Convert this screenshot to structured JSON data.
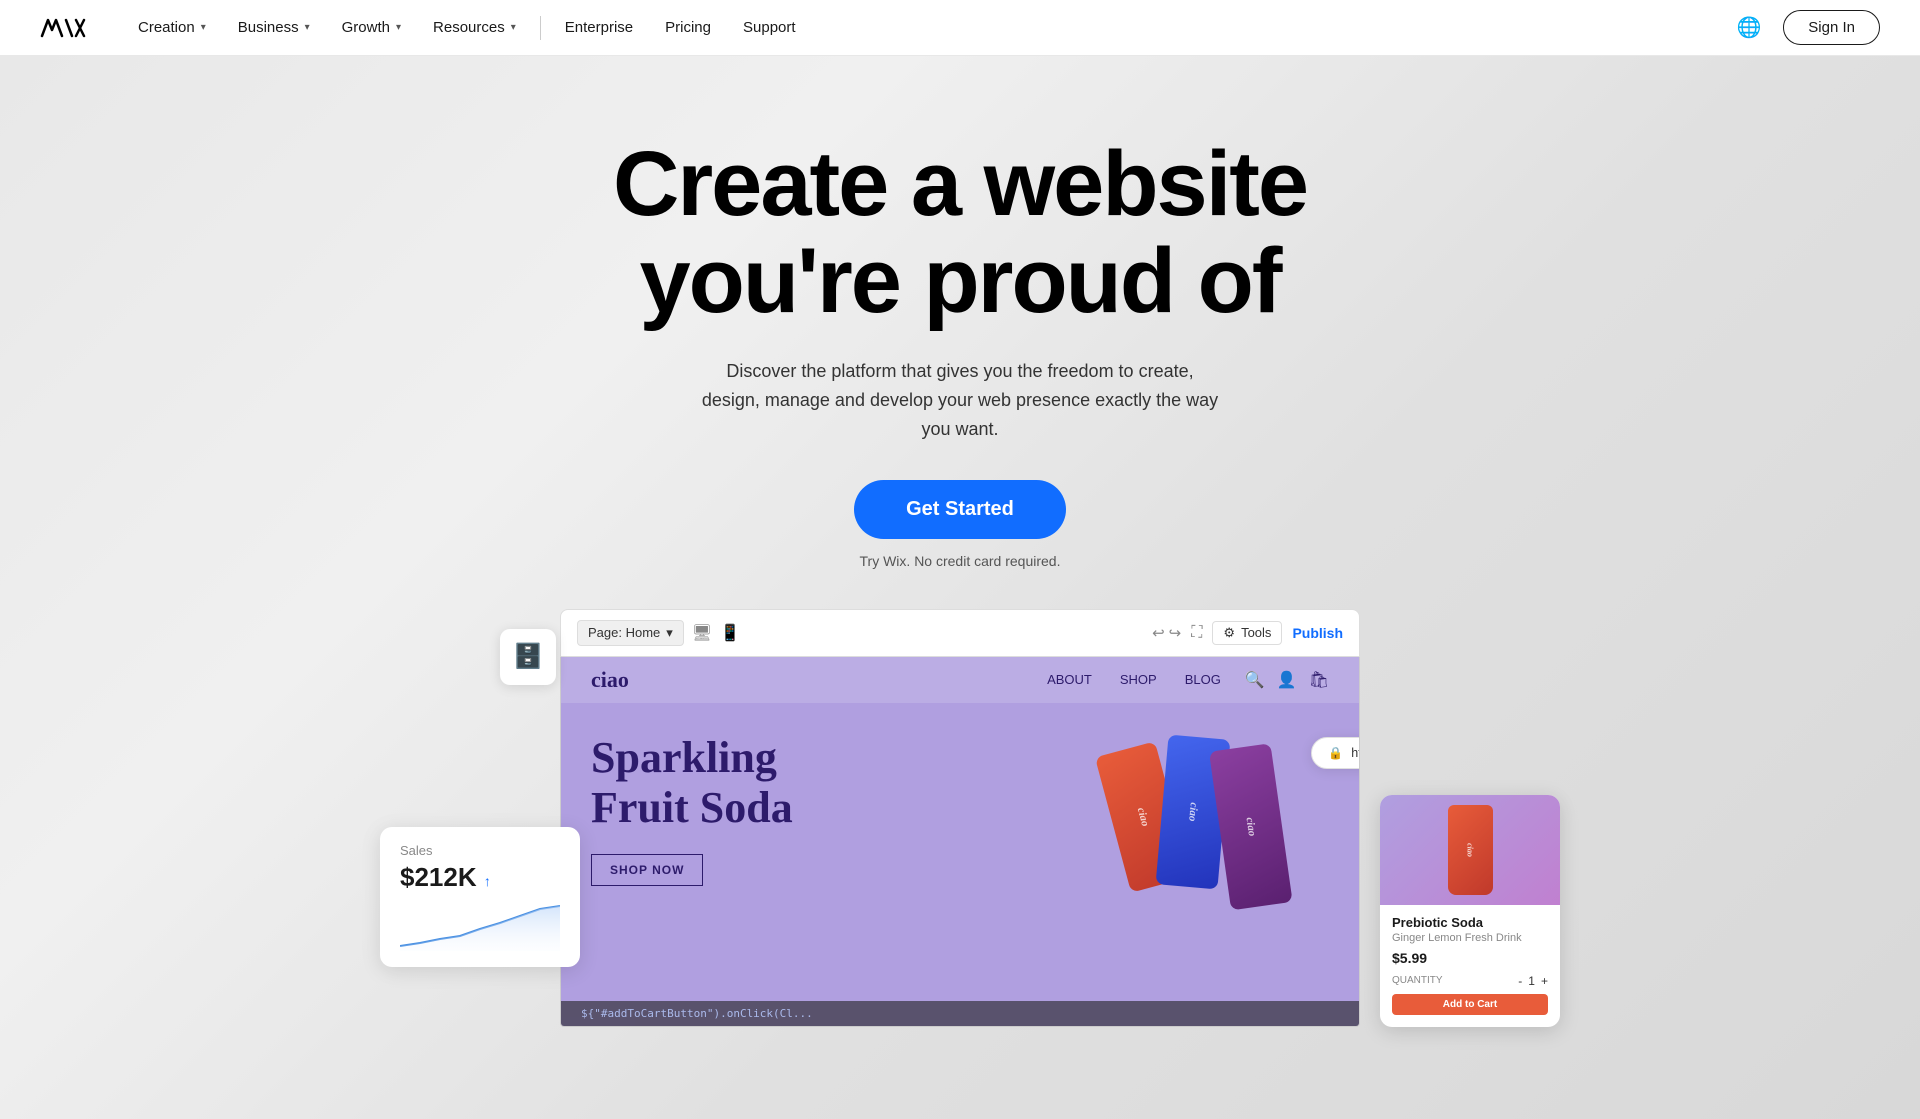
{
  "navbar": {
    "logo_text": "Wix",
    "items": [
      {
        "label": "Creation",
        "has_dropdown": true
      },
      {
        "label": "Business",
        "has_dropdown": true
      },
      {
        "label": "Growth",
        "has_dropdown": true
      },
      {
        "label": "Resources",
        "has_dropdown": true
      }
    ],
    "standalone_items": [
      {
        "label": "Enterprise"
      },
      {
        "label": "Pricing"
      },
      {
        "label": "Support"
      }
    ],
    "signin_label": "Sign In",
    "globe_icon": "🌐"
  },
  "hero": {
    "title_line1": "Create a website",
    "title_line2": "you're proud of",
    "subtitle": "Discover the platform that gives you the freedom to create, design, manage and develop your web presence exactly the way you want.",
    "cta_label": "Get Started",
    "cta_note": "Try Wix. No credit card required."
  },
  "browser_mockup": {
    "page_selector": "Page: Home",
    "tools_label": "Tools",
    "publish_label": "Publish",
    "url": "https://www.ciaodrinks.com"
  },
  "site_preview": {
    "brand": "ciao",
    "nav_links": [
      "ABOUT",
      "SHOP",
      "BLOG"
    ],
    "hero_text_line1": "Sparkling",
    "hero_text_line2": "Fruit Soda",
    "shop_now": "SHOP NOW"
  },
  "sales_card": {
    "label": "Sales",
    "value": "$212K"
  },
  "product_card": {
    "name": "Prebiotic Soda",
    "description": "Ginger Lemon Fresh Drink",
    "price": "$5.99",
    "quantity": "1",
    "quantity_label": "QUANTITY",
    "add_to_cart": "Add to Cart"
  },
  "code_line": "${\"#addToCartButton\").onClick(Cl..."
}
